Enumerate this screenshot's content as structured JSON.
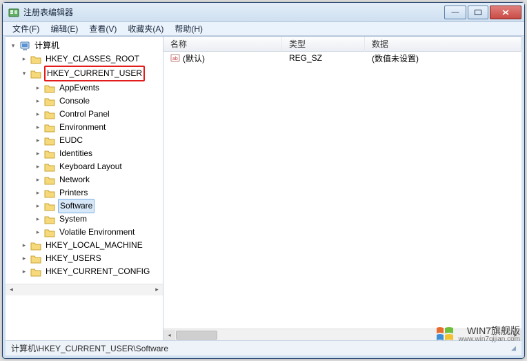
{
  "window": {
    "title": "注册表编辑器"
  },
  "menu": {
    "file": "文件(F)",
    "edit": "编辑(E)",
    "view": "查看(V)",
    "favorites": "收藏夹(A)",
    "help": "帮助(H)"
  },
  "tree": {
    "root": "计算机",
    "hives": [
      {
        "label": "HKEY_CLASSES_ROOT",
        "highlighted": false
      },
      {
        "label": "HKEY_CURRENT_USER",
        "highlighted": true,
        "expanded": true,
        "children": [
          {
            "label": "AppEvents"
          },
          {
            "label": "Console"
          },
          {
            "label": "Control Panel"
          },
          {
            "label": "Environment"
          },
          {
            "label": "EUDC"
          },
          {
            "label": "Identities"
          },
          {
            "label": "Keyboard Layout"
          },
          {
            "label": "Network"
          },
          {
            "label": "Printers"
          },
          {
            "label": "Software",
            "highlighted": true,
            "selected": true
          },
          {
            "label": "System"
          },
          {
            "label": "Volatile Environment"
          }
        ]
      },
      {
        "label": "HKEY_LOCAL_MACHINE"
      },
      {
        "label": "HKEY_USERS"
      },
      {
        "label": "HKEY_CURRENT_CONFIG"
      }
    ]
  },
  "list": {
    "columns": {
      "name": "名称",
      "type": "类型",
      "data": "数据"
    },
    "rows": [
      {
        "name": "(默认)",
        "type": "REG_SZ",
        "data": "(数值未设置)"
      }
    ]
  },
  "statusbar": {
    "path": "计算机\\HKEY_CURRENT_USER\\Software"
  },
  "watermark": {
    "line1": "WIN7旗舰版",
    "line2": "www.win7qijian.com"
  },
  "icons": {
    "app": "regedit-icon",
    "computer": "computer-icon",
    "folder": "folder-icon",
    "string_value": "string-value-icon",
    "flag": "windows-flag-icon"
  }
}
